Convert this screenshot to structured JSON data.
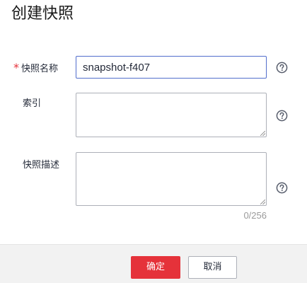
{
  "dialog": {
    "title": "创建快照"
  },
  "form": {
    "name": {
      "required_mark": "*",
      "label": "快照名称",
      "value": "snapshot-f407"
    },
    "index": {
      "label": "索引",
      "value": ""
    },
    "description": {
      "label": "快照描述",
      "value": "",
      "counter": "0/256"
    }
  },
  "icons": {
    "help": "question-circle-icon"
  },
  "footer": {
    "confirm_label": "确定",
    "cancel_label": "取消"
  },
  "colors": {
    "primary": "#e5323a",
    "input_focus_border": "#526ecc",
    "footer_bg": "#f2f2f2"
  }
}
